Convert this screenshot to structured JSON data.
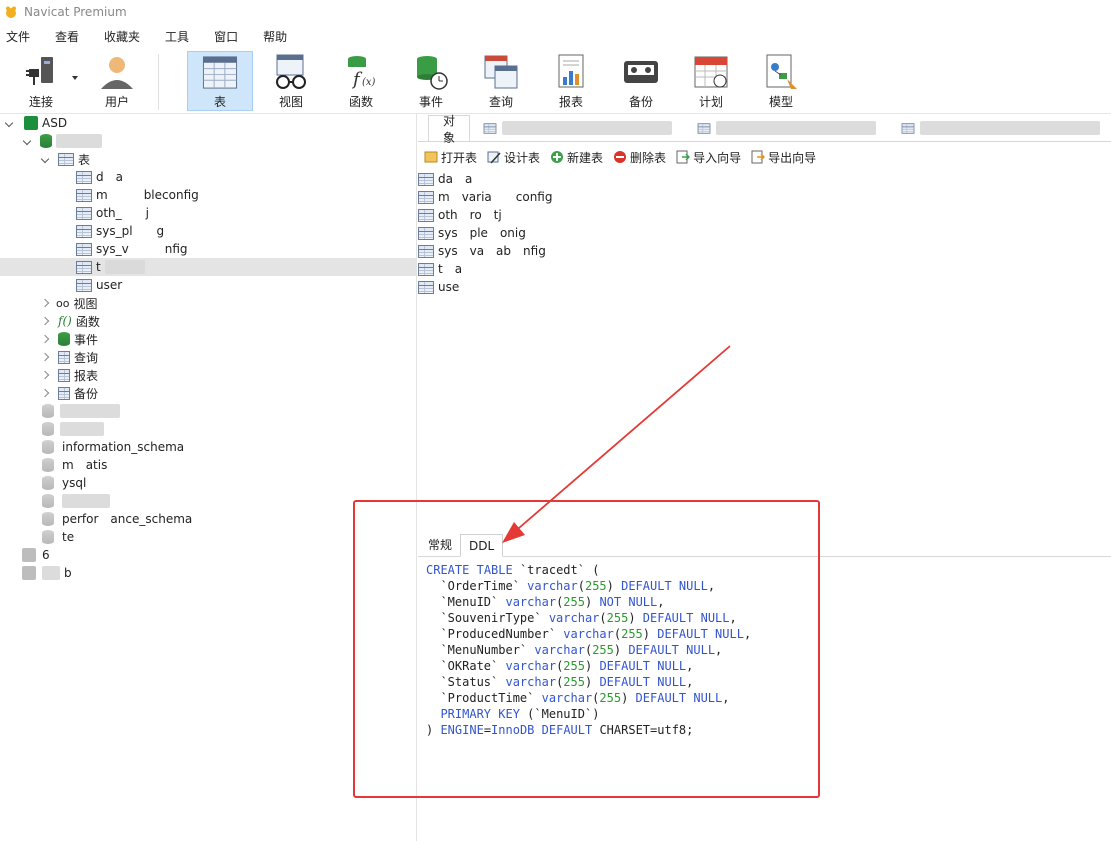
{
  "app": {
    "title": "Navicat Premium"
  },
  "menu": [
    "文件",
    "查看",
    "收藏夹",
    "工具",
    "窗口",
    "帮助"
  ],
  "toolbar": {
    "buttons": [
      {
        "label": "连接",
        "icon": "plug-icon"
      },
      {
        "label": "用户",
        "icon": "user-icon"
      },
      {
        "label": "表",
        "icon": "table-icon",
        "active": true
      },
      {
        "label": "视图",
        "icon": "view-glasses-icon"
      },
      {
        "label": "函数",
        "icon": "function-icon"
      },
      {
        "label": "事件",
        "icon": "event-icon"
      },
      {
        "label": "查询",
        "icon": "query-icon"
      },
      {
        "label": "报表",
        "icon": "report-icon"
      },
      {
        "label": "备份",
        "icon": "backup-icon"
      },
      {
        "label": "计划",
        "icon": "calendar-icon"
      },
      {
        "label": "模型",
        "icon": "model-icon"
      }
    ]
  },
  "tree": {
    "connection": "ASD",
    "group_tables": "表",
    "tables": [
      "d a",
      "m   bleconfig",
      "oth_  j",
      "sys_pl  g",
      "sys_v   nfig",
      "t",
      "user"
    ],
    "categories": [
      "视图",
      "函数",
      "事件",
      "查询",
      "报表",
      "备份"
    ],
    "databases": [
      "information_schema",
      "m atis",
      "ysql",
      "perfor ance_schema",
      "te"
    ],
    "other_connections": [
      "6",
      "b"
    ]
  },
  "object_tabs": {
    "active": "对象"
  },
  "object_toolbar": [
    "打开表",
    "设计表",
    "新建表",
    "删除表",
    "导入向导",
    "导出向导"
  ],
  "object_list": [
    "da a",
    "m varia  config",
    "oth ro tj",
    "sys ple onig",
    "sys va ab nfig",
    "t a",
    "use"
  ],
  "info": {
    "tabs": [
      "常规",
      "DDL"
    ],
    "active_tab": "DDL",
    "ddl_lines": [
      "CREATE TABLE `tracedt` (",
      "  `OrderTime` varchar(255) DEFAULT NULL,",
      "  `MenuID` varchar(255) NOT NULL,",
      "  `SouvenirType` varchar(255) DEFAULT NULL,",
      "  `ProducedNumber` varchar(255) DEFAULT NULL,",
      "  `MenuNumber` varchar(255) DEFAULT NULL,",
      "  `OKRate` varchar(255) DEFAULT NULL,",
      "  `Status` varchar(255) DEFAULT NULL,",
      "  `ProductTime` varchar(255) DEFAULT NULL,",
      "  PRIMARY KEY (`MenuID`)",
      ") ENGINE=InnoDB DEFAULT CHARSET=utf8;"
    ]
  },
  "colors": {
    "highlight": "#e53935",
    "active_tool": "#cfe6fa",
    "keyword": "#3355cc",
    "number": "#2a9a2a"
  }
}
